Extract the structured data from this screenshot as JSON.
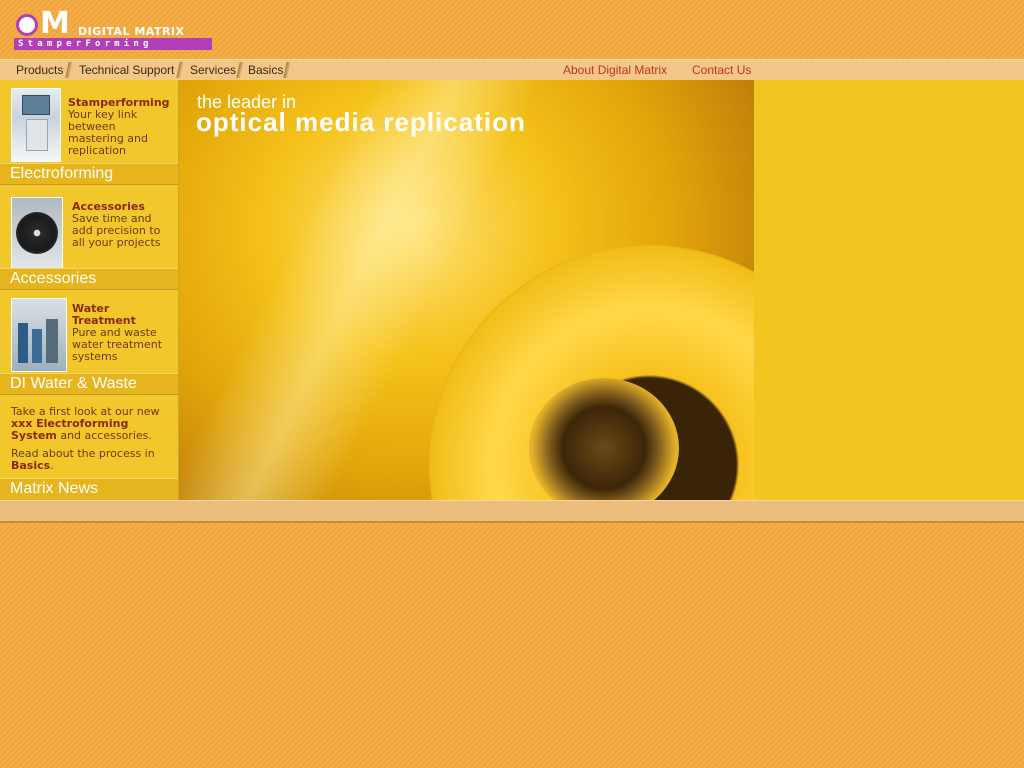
{
  "header": {
    "logo_letters": "OM",
    "logo_brand": "DIGITAL MATRIX",
    "logo_tagline": "StamperForming"
  },
  "nav": {
    "left": [
      "Products",
      "Technical Support",
      "Services",
      "Basics"
    ],
    "right": [
      "About Digital Matrix",
      "Contact Us"
    ]
  },
  "sidebar": {
    "panels": [
      {
        "title": "Stamperforming",
        "desc": "Your key link between mastering and replication",
        "band": "Electroforming"
      },
      {
        "title": "Accessories",
        "desc": "Save time and add precision to all your projects",
        "band": "Accessories"
      },
      {
        "title": "Water Treatment",
        "desc": "Pure and waste water treatment systems",
        "band": "DI Water & Waste"
      }
    ],
    "news": {
      "line1_a": "Take a first look at our new ",
      "line1_b": "xxx Electroforming System",
      "line1_c": " and accessories.",
      "line2_a": "Read about the process in ",
      "line2_b": "Basics",
      "line2_c": ".",
      "band": "Matrix News"
    }
  },
  "hero": {
    "subtitle": "the leader in",
    "headline": "optical media replication"
  },
  "colors": {
    "background": "#f5a93e",
    "sidebar": "#f2c72c",
    "accent_red": "#c8321a",
    "logo_purple": "#b23fb8"
  }
}
